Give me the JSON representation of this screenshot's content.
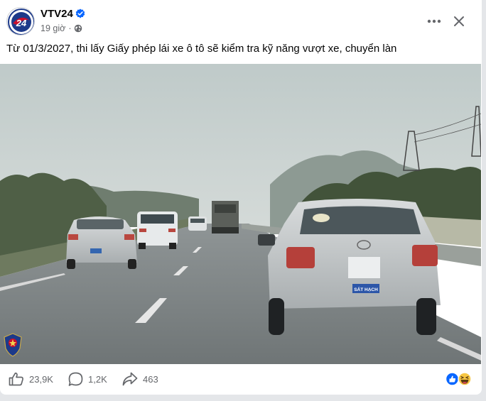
{
  "post": {
    "page_name": "VTV24",
    "verified": true,
    "time": "19 giờ",
    "separator": "·",
    "caption": "Từ 01/3/2027, thi lấy Giấy phép lái xe ô tô sẽ kiểm tra kỹ năng vượt xe, chuyển làn",
    "avatar_text": "24",
    "plate_label": "SÁT HẠCH"
  },
  "actions": {
    "likes": "23,9K",
    "comments": "1,2K",
    "shares": "463"
  },
  "icons": {
    "more": "more-horizontal-icon",
    "close": "close-icon",
    "privacy": "globe-icon",
    "like": "thumbs-up-icon",
    "comment": "comment-bubble-icon",
    "share": "share-arrow-icon",
    "reaction_like": "like-reaction-icon",
    "reaction_haha": "haha-reaction-icon"
  },
  "colors": {
    "brand_blue": "#0866ff",
    "text_secondary": "#65676b",
    "vtv_red": "#c8102e"
  }
}
